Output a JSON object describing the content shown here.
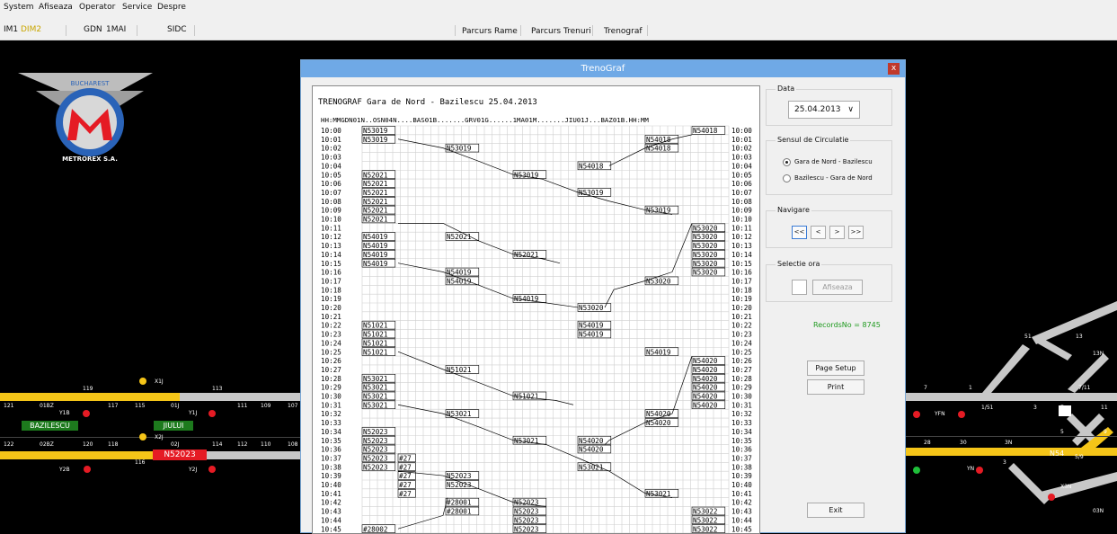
{
  "menu": {
    "items": [
      "System",
      "Afiseaza",
      "Operator",
      "Service",
      "Despre"
    ]
  },
  "toolbar": {
    "im1": "IM1",
    "dim2": "DIM2",
    "gdn": "GDN",
    "mai1": "1MAI",
    "sidc": "SIDC"
  },
  "view_tabs": [
    "Parcurs Rame",
    "Parcurs Trenuri",
    "Trenograf"
  ],
  "logo": {
    "top_text": "BUCHAREST",
    "bottom_text": "METROREX S.A."
  },
  "colors": {
    "track_yellow": "#f5c518",
    "track_grey": "#c8c8c8",
    "station_green": "#1d7a1d",
    "train_red": "#e51b24",
    "signal_red": "#e51b24",
    "signal_green": "#1fbf3a",
    "title_blue": "#6fa9e6"
  },
  "track": {
    "stations": [
      "BAZILESCU",
      "JIULUI"
    ],
    "train_tag": "N52023",
    "labels": [
      "X1J",
      "119",
      "113",
      "121",
      "01BZ",
      "117",
      "115",
      "01J",
      "111",
      "109",
      "107",
      "Y1B",
      "Y1J",
      "X2J",
      "122",
      "02BZ",
      "120",
      "118",
      "02J",
      "114",
      "112",
      "110",
      "108",
      "116",
      "Y2B",
      "Y2J"
    ],
    "right_labels": [
      "51",
      "13",
      "13N",
      "7",
      "1",
      "0",
      "7/11",
      "YFN",
      "1/51",
      "3",
      "7",
      "11",
      "5",
      "9",
      "28",
      "30",
      "3N",
      "N54",
      "5/9",
      "YN",
      "3",
      "X3N",
      "03N"
    ]
  },
  "trenograf_window": {
    "title": "TrenoGraf",
    "close_label": "x",
    "report": {
      "header": "TRENOGRAF   Gara de Nord - Bazilescu   25.04.2013",
      "column_header": "HH:MMGDN01N..OSN04N....BAS01B.......GRV01G......1MA01M.......JIU01J...BAZ01B.HH:MM",
      "times": [
        "10:00",
        "10:01",
        "10:02",
        "10:03",
        "10:04",
        "10:05",
        "10:06",
        "10:07",
        "10:08",
        "10:09",
        "10:10",
        "10:11",
        "10:12",
        "10:13",
        "10:14",
        "10:15",
        "10:16",
        "10:17",
        "10:18",
        "10:19",
        "10:20",
        "10:21",
        "10:22",
        "10:23",
        "10:24",
        "10:25",
        "10:26",
        "10:27",
        "10:28",
        "10:29",
        "10:30",
        "10:31",
        "10:32",
        "10:33",
        "10:34",
        "10:35",
        "10:36",
        "10:37",
        "10:38",
        "10:39",
        "10:40",
        "10:41",
        "10:42",
        "10:43",
        "10:44",
        "10:45"
      ],
      "train_labels": [
        {
          "t": 0,
          "col": 0,
          "text": "N53019"
        },
        {
          "t": 1,
          "col": 0,
          "text": "N53019"
        },
        {
          "t": 2,
          "col": 2,
          "text": "N53019"
        },
        {
          "t": 5,
          "col": 3,
          "text": "N53019"
        },
        {
          "t": 7,
          "col": 4,
          "text": "N53019"
        },
        {
          "t": 9,
          "col": 5,
          "text": "N53019"
        },
        {
          "t": 0,
          "col": 6,
          "text": "N54018"
        },
        {
          "t": 1,
          "col": 5,
          "text": "N54018"
        },
        {
          "t": 2,
          "col": 5,
          "text": "N54018"
        },
        {
          "t": 4,
          "col": 4,
          "text": "N54018"
        },
        {
          "t": 5,
          "col": 0,
          "text": "N52021"
        },
        {
          "t": 6,
          "col": 0,
          "text": "N52021"
        },
        {
          "t": 7,
          "col": 0,
          "text": "N52021"
        },
        {
          "t": 8,
          "col": 0,
          "text": "N52021"
        },
        {
          "t": 9,
          "col": 0,
          "text": "N52021"
        },
        {
          "t": 10,
          "col": 0,
          "text": "N52021"
        },
        {
          "t": 12,
          "col": 2,
          "text": "N52021"
        },
        {
          "t": 14,
          "col": 3,
          "text": "N52021"
        },
        {
          "t": 11,
          "col": 6,
          "text": "N53020"
        },
        {
          "t": 12,
          "col": 6,
          "text": "N53020"
        },
        {
          "t": 13,
          "col": 6,
          "text": "N53020"
        },
        {
          "t": 14,
          "col": 6,
          "text": "N53020"
        },
        {
          "t": 15,
          "col": 6,
          "text": "N53020"
        },
        {
          "t": 16,
          "col": 6,
          "text": "N53020"
        },
        {
          "t": 17,
          "col": 5,
          "text": "N53020"
        },
        {
          "t": 20,
          "col": 4,
          "text": "N53020"
        },
        {
          "t": 12,
          "col": 0,
          "text": "N54019"
        },
        {
          "t": 13,
          "col": 0,
          "text": "N54019"
        },
        {
          "t": 14,
          "col": 0,
          "text": "N54019"
        },
        {
          "t": 15,
          "col": 0,
          "text": "N54019"
        },
        {
          "t": 16,
          "col": 2,
          "text": "N54019"
        },
        {
          "t": 17,
          "col": 2,
          "text": "N54019"
        },
        {
          "t": 19,
          "col": 3,
          "text": "N54019"
        },
        {
          "t": 22,
          "col": 4,
          "text": "N54019"
        },
        {
          "t": 23,
          "col": 4,
          "text": "N54019"
        },
        {
          "t": 25,
          "col": 5,
          "text": "N54019"
        },
        {
          "t": 22,
          "col": 0,
          "text": "N51021"
        },
        {
          "t": 23,
          "col": 0,
          "text": "N51021"
        },
        {
          "t": 24,
          "col": 0,
          "text": "N51021"
        },
        {
          "t": 25,
          "col": 0,
          "text": "N51021"
        },
        {
          "t": 27,
          "col": 2,
          "text": "N51021"
        },
        {
          "t": 30,
          "col": 3,
          "text": "N51021"
        },
        {
          "t": 26,
          "col": 6,
          "text": "N54020"
        },
        {
          "t": 27,
          "col": 6,
          "text": "N54020"
        },
        {
          "t": 28,
          "col": 6,
          "text": "N54020"
        },
        {
          "t": 29,
          "col": 6,
          "text": "N54020"
        },
        {
          "t": 30,
          "col": 6,
          "text": "N54020"
        },
        {
          "t": 31,
          "col": 6,
          "text": "N54020"
        },
        {
          "t": 32,
          "col": 5,
          "text": "N54020"
        },
        {
          "t": 33,
          "col": 5,
          "text": "N54020"
        },
        {
          "t": 35,
          "col": 4,
          "text": "N54020"
        },
        {
          "t": 36,
          "col": 4,
          "text": "N54020"
        },
        {
          "t": 28,
          "col": 0,
          "text": "N53021"
        },
        {
          "t": 29,
          "col": 0,
          "text": "N53021"
        },
        {
          "t": 30,
          "col": 0,
          "text": "N53021"
        },
        {
          "t": 31,
          "col": 0,
          "text": "N53021"
        },
        {
          "t": 32,
          "col": 2,
          "text": "N53021"
        },
        {
          "t": 35,
          "col": 3,
          "text": "N53021"
        },
        {
          "t": 38,
          "col": 4,
          "text": "N53021"
        },
        {
          "t": 41,
          "col": 5,
          "text": "N53021"
        },
        {
          "t": 34,
          "col": 0,
          "text": "N52023"
        },
        {
          "t": 35,
          "col": 0,
          "text": "N52023"
        },
        {
          "t": 36,
          "col": 0,
          "text": "N52023"
        },
        {
          "t": 37,
          "col": 0,
          "text": "N52023"
        },
        {
          "t": 38,
          "col": 0,
          "text": "N52023"
        },
        {
          "t": 39,
          "col": 2,
          "text": "N52023"
        },
        {
          "t": 40,
          "col": 2,
          "text": "N52023"
        },
        {
          "t": 42,
          "col": 3,
          "text": "N52023"
        },
        {
          "t": 43,
          "col": 3,
          "text": "N52023"
        },
        {
          "t": 44,
          "col": 3,
          "text": "N52023"
        },
        {
          "t": 45,
          "col": 3,
          "text": "N52023"
        },
        {
          "t": 37,
          "col": 1,
          "text": "#27"
        },
        {
          "t": 38,
          "col": 1,
          "text": "#27"
        },
        {
          "t": 39,
          "col": 1,
          "text": "#27"
        },
        {
          "t": 40,
          "col": 1,
          "text": "#27"
        },
        {
          "t": 41,
          "col": 1,
          "text": "#27"
        },
        {
          "t": 42,
          "col": 2,
          "text": "#28001"
        },
        {
          "t": 43,
          "col": 2,
          "text": "#28001"
        },
        {
          "t": 45,
          "col": 0,
          "text": "#28002"
        },
        {
          "t": 43,
          "col": 6,
          "text": "N53022"
        },
        {
          "t": 44,
          "col": 6,
          "text": "N53022"
        },
        {
          "t": 45,
          "col": 6,
          "text": "N53022"
        }
      ]
    },
    "data": {
      "label": "Data",
      "value": "25.04.2013",
      "arrow": "∨"
    },
    "direction": {
      "label": "Sensul  de Circulatie",
      "options": [
        "Gara de Nord - Bazilescu",
        "Bazilescu - Gara de Nord"
      ],
      "selected": 0
    },
    "navigation": {
      "label": "Navigare",
      "buttons": [
        "<<",
        "<",
        ">",
        ">>"
      ]
    },
    "hour": {
      "label": "Selectie ora",
      "button": "Afiseaza"
    },
    "records": "RecordsNo = 8745",
    "page_setup": "Page Setup",
    "print": "Print",
    "exit": "Exit"
  }
}
